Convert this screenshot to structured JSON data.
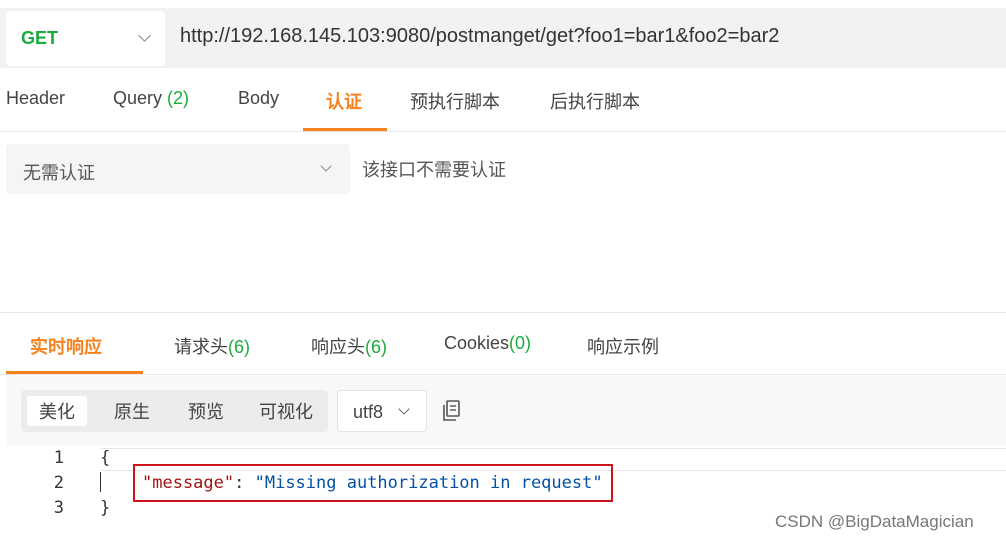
{
  "request": {
    "method": "GET",
    "url": "http://192.168.145.103:9080/postmanget/get?foo1=bar1&foo2=bar2"
  },
  "request_tabs": {
    "header": "Header",
    "query": "Query",
    "query_count": "(2)",
    "body": "Body",
    "auth": "认证",
    "pre_script": "预执行脚本",
    "post_script": "后执行脚本",
    "active": "auth"
  },
  "auth": {
    "type_selected": "无需认证",
    "hint": "该接口不需要认证"
  },
  "response_tabs": {
    "realtime": "实时响应",
    "request_headers": "请求头",
    "request_headers_count": "(6)",
    "response_headers": "响应头",
    "response_headers_count": "(6)",
    "cookies": "Cookies",
    "cookies_count": "(0)",
    "examples": "响应示例",
    "active": "realtime"
  },
  "response_view": {
    "pretty": "美化",
    "raw": "原生",
    "preview": "预览",
    "visualize": "可视化",
    "active": "pretty",
    "encoding": "utf8"
  },
  "response_body": {
    "line_numbers": [
      "1",
      "2",
      "3"
    ],
    "open_brace": "{",
    "key": "\"message\"",
    "colon": ": ",
    "value": "\"Missing authorization in request\"",
    "close_brace": "}"
  },
  "watermark": "CSDN @BigDataMagician",
  "colors": {
    "accent": "#f5821f",
    "method_green": "#1aab3f",
    "highlight_red": "#d0121b"
  }
}
